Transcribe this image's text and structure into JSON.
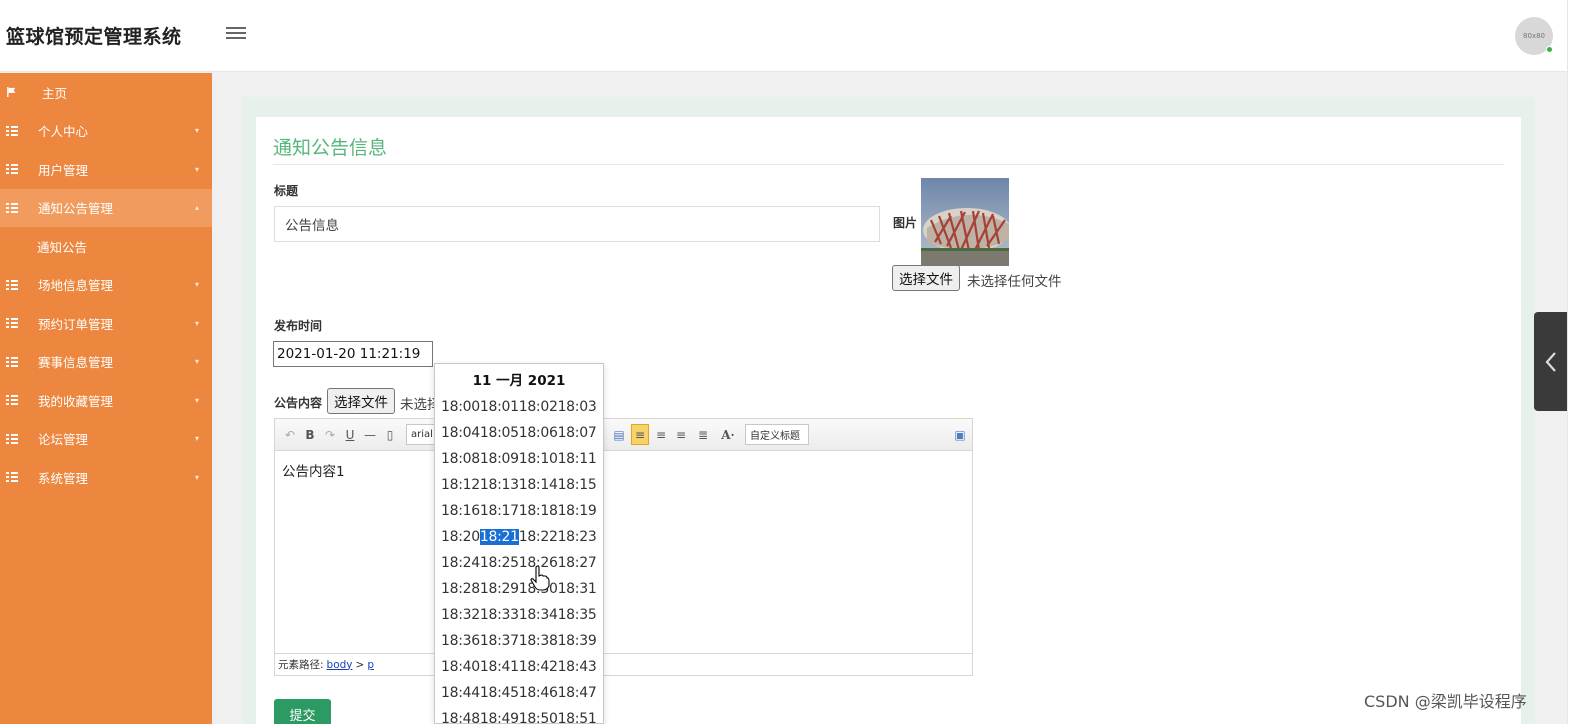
{
  "header": {
    "app_title": "篮球馆预定管理系统",
    "avatar_text": "80x80"
  },
  "sidebar": {
    "items": [
      {
        "label": "主页",
        "icon": "flag-icon"
      },
      {
        "label": "个人中心",
        "icon": "grid-icon"
      },
      {
        "label": "用户管理",
        "icon": "grid-icon"
      },
      {
        "label": "通知公告管理",
        "icon": "grid-icon",
        "expanded": true
      },
      {
        "label": "场地信息管理",
        "icon": "grid-icon"
      },
      {
        "label": "预约订单管理",
        "icon": "grid-icon"
      },
      {
        "label": "赛事信息管理",
        "icon": "grid-icon"
      },
      {
        "label": "我的收藏管理",
        "icon": "grid-icon"
      },
      {
        "label": "论坛管理",
        "icon": "grid-icon"
      },
      {
        "label": "系统管理",
        "icon": "grid-icon"
      }
    ],
    "subitem": "通知公告"
  },
  "form": {
    "title": "通知公告信息",
    "title_label": "标题",
    "title_value": "公告信息",
    "image_label": "图片",
    "file_button": "选择文件",
    "file_status": "未选择任何文件",
    "date_label": "发布时间",
    "date_value": "2021-01-20 11:21:19",
    "content_label": "公告内容",
    "content_file_button": "选择文件",
    "content_file_status": "未选择",
    "submit": "提交"
  },
  "editor": {
    "font_select": "arial",
    "heading_select": "自定义标题",
    "body_text": "公告内容1",
    "path_label": "元素路径:",
    "path_body": "body",
    "path_sep": ">",
    "path_p": "p"
  },
  "time_picker": {
    "header": "11 一月 2021",
    "rows": [
      [
        "18:00",
        "18:01",
        "18:02",
        "18:03"
      ],
      [
        "18:04",
        "18:05",
        "18:06",
        "18:07"
      ],
      [
        "18:08",
        "18:09",
        "18:10",
        "18:11"
      ],
      [
        "18:12",
        "18:13",
        "18:14",
        "18:15"
      ],
      [
        "18:16",
        "18:17",
        "18:18",
        "18:19"
      ],
      [
        "18:20",
        "18:21",
        "18:22",
        "18:23"
      ],
      [
        "18:24",
        "18:25",
        "18:26",
        "18:27"
      ],
      [
        "18:28",
        "18:29",
        "18:30",
        "18:31"
      ],
      [
        "18:32",
        "18:33",
        "18:34",
        "18:35"
      ],
      [
        "18:36",
        "18:37",
        "18:38",
        "18:39"
      ],
      [
        "18:40",
        "18:41",
        "18:42",
        "18:43"
      ],
      [
        "18:44",
        "18:45",
        "18:46",
        "18:47"
      ],
      [
        "18:48",
        "18:49",
        "18:50",
        "18:51"
      ]
    ],
    "selected": "18:21"
  },
  "watermark": "CSDN @梁凯毕设程序",
  "colors": {
    "sidebar": "#ed873f",
    "accent_green": "#56b67b",
    "submit": "#2c9a63",
    "selected": "#1a6fd4"
  }
}
